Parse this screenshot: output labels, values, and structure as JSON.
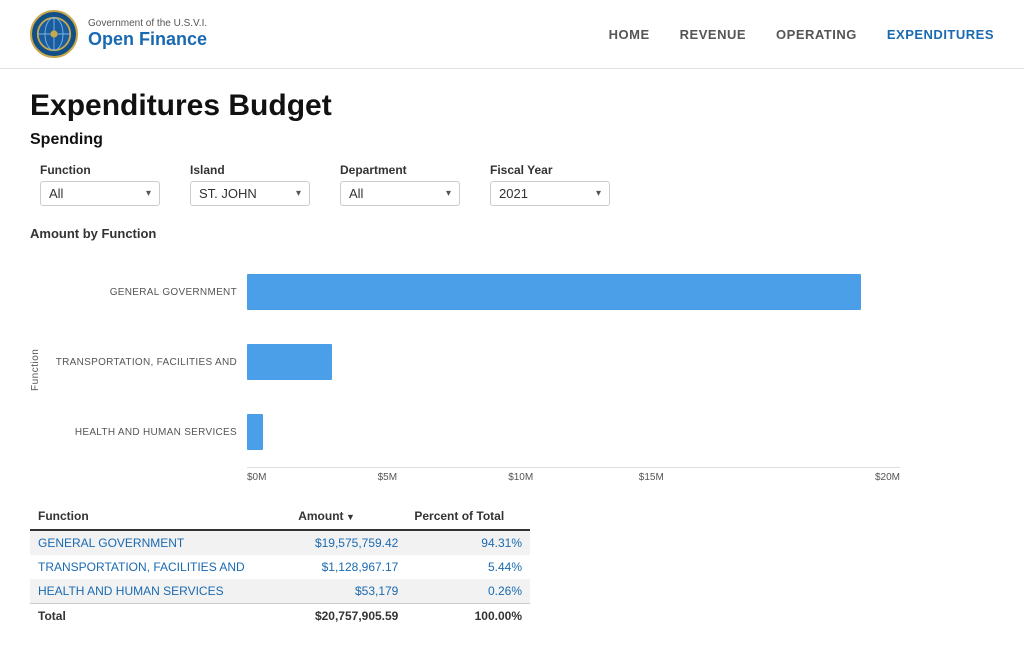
{
  "header": {
    "logo_gov": "Government of the U.S.V.I.",
    "logo_name": "Open Finance",
    "nav": [
      {
        "label": "HOME",
        "active": false
      },
      {
        "label": "REVENUE",
        "active": false
      },
      {
        "label": "OPERATING",
        "active": false
      },
      {
        "label": "EXPENDITURES",
        "active": true
      }
    ]
  },
  "page": {
    "title": "Expenditures Budget",
    "section": "Spending"
  },
  "filters": [
    {
      "label": "Function",
      "value": "All"
    },
    {
      "label": "Island",
      "value": "ST. JOHN"
    },
    {
      "label": "Department",
      "value": "All"
    },
    {
      "label": "Fiscal Year",
      "value": "2021"
    }
  ],
  "chart": {
    "title": "Amount by Function",
    "y_axis_label": "Function",
    "bars": [
      {
        "label": "GENERAL GOVERNMENT",
        "width_pct": 94.0
      },
      {
        "label": "TRANSPORTATION, FACILITIES AND",
        "width_pct": 13.0
      },
      {
        "label": "HEALTH AND HUMAN SERVICES",
        "width_pct": 2.5
      }
    ],
    "x_ticks": [
      "$0M",
      "$5M",
      "$10M",
      "$15M",
      "$20M"
    ]
  },
  "table": {
    "columns": [
      {
        "label": "Function",
        "sortable": false
      },
      {
        "label": "Amount",
        "sortable": true
      },
      {
        "label": "Percent of Total",
        "sortable": false
      }
    ],
    "rows": [
      {
        "function": "GENERAL GOVERNMENT",
        "amount": "$19,575,759.42",
        "pct": "94.31%"
      },
      {
        "function": "TRANSPORTATION, FACILITIES AND",
        "amount": "$1,128,967.17",
        "pct": "5.44%"
      },
      {
        "function": "HEALTH AND HUMAN SERVICES",
        "amount": "$53,179",
        "pct": "0.26%"
      }
    ],
    "total": {
      "label": "Total",
      "amount": "$20,757,905.59",
      "pct": "100.00%"
    }
  }
}
